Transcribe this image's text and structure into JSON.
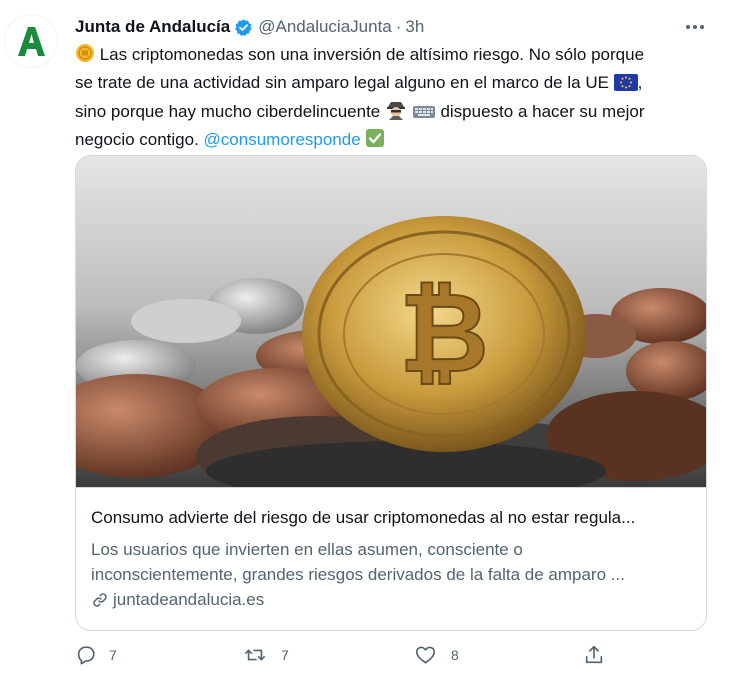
{
  "tweet": {
    "author_name": "Junta de Andalucía",
    "handle": "@AndaluciaJunta",
    "separator": "·",
    "time": "3h",
    "line1_text": " Las criptomonedas son una inversión de altísimo riesgo. No sólo porque",
    "line2_text": "se trate de una actividad sin amparo legal alguno en el marco de la UE ",
    "line3_text": "sino porque hay mucho ciberdelincuente ",
    "line3_tail": " dispuesto a hacer su mejor",
    "line4_text": "negocio contigo. ",
    "mention": "@consumoresponde",
    "trailing_comma": ","
  },
  "card": {
    "title": "Consumo advierte del riesgo de usar criptomonedas al no estar regula...",
    "description_line1": "Los usuarios que invierten en ellas asumen, consciente o",
    "description_line2": "inconscientemente, grandes riesgos derivados de la falta de amparo ...",
    "domain": "juntadeandalucia.es"
  },
  "actions": {
    "reply_count": "7",
    "retweet_count": "7",
    "like_count": "8"
  },
  "colors": {
    "accent": "#1d9bf0",
    "logo_green": "#1a8a3c",
    "secondary_text": "#536471"
  },
  "icons": [
    "logo-a",
    "verified-badge-icon",
    "more-dots-icon",
    "coin-emoji",
    "eu-flag-emoji",
    "detective-emoji",
    "keyboard-emoji",
    "check-mark-emoji",
    "link-icon",
    "reply-icon",
    "retweet-icon",
    "like-icon",
    "share-icon"
  ]
}
